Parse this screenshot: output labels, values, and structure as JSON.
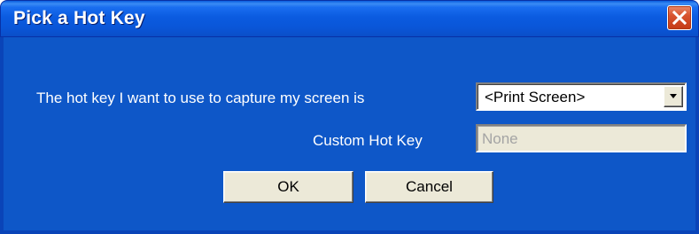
{
  "window": {
    "title": "Pick a Hot Key",
    "close_icon": "close-icon"
  },
  "form": {
    "hotkey_label": "The hot key I want to use to capture my screen is",
    "hotkey_selected": "<Print Screen>",
    "custom_label": "Custom Hot Key",
    "custom_value": "None"
  },
  "buttons": {
    "ok": "OK",
    "cancel": "Cancel"
  },
  "colors": {
    "titlebar": "#0b5be0",
    "body": "#0e57c8",
    "close": "#d8532f",
    "control_face": "#ece9d8"
  }
}
